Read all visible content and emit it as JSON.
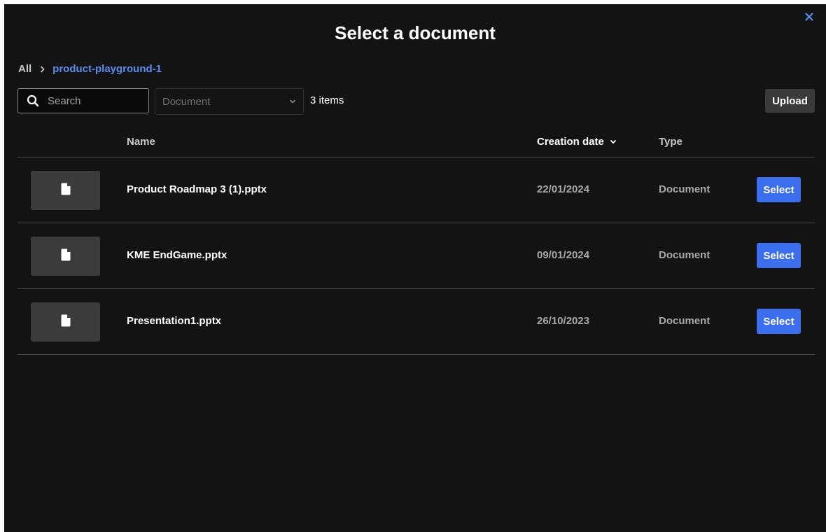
{
  "dialog": {
    "title": "Select a document",
    "close_icon": "close-icon",
    "accent_color": "#3b6fef",
    "link_color": "#5b8def"
  },
  "breadcrumb": {
    "root": "All",
    "separator_icon": "chevron-right-icon",
    "current": "product-playground-1"
  },
  "toolbar": {
    "search": {
      "icon": "search-icon",
      "placeholder": "Search",
      "value": ""
    },
    "type_filter": {
      "selected": "Document",
      "icon": "chevron-down-icon"
    },
    "item_count": "3 items",
    "upload_label": "Upload"
  },
  "table": {
    "columns": {
      "name": "Name",
      "creation_date": "Creation date",
      "type": "Type"
    },
    "sort_icon": "chevron-down-icon",
    "rows": [
      {
        "icon": "document-icon",
        "name": "Product Roadmap 3 (1).pptx",
        "date": "22/01/2024",
        "type": "Document",
        "action": "Select"
      },
      {
        "icon": "document-icon",
        "name": "KME EndGame.pptx",
        "date": "09/01/2024",
        "type": "Document",
        "action": "Select"
      },
      {
        "icon": "document-icon",
        "name": "Presentation1.pptx",
        "date": "26/10/2023",
        "type": "Document",
        "action": "Select"
      }
    ]
  }
}
